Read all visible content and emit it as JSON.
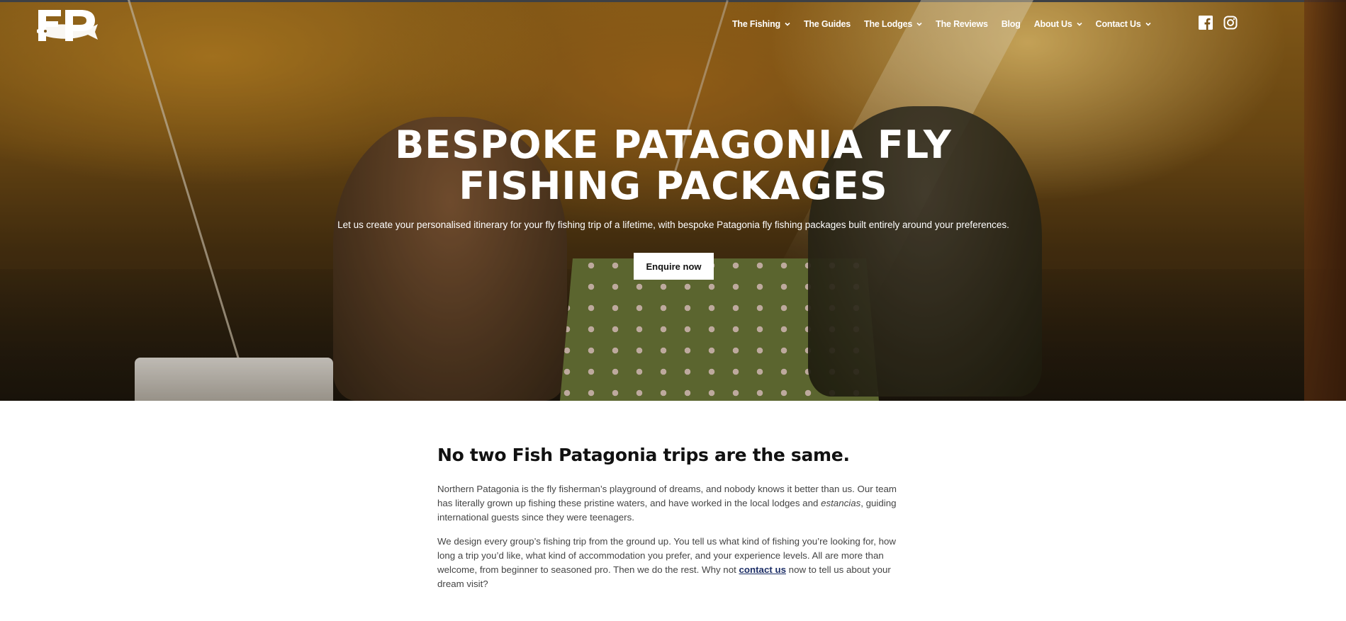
{
  "nav": {
    "items": [
      {
        "label": "The Fishing",
        "has_dropdown": true
      },
      {
        "label": "The Guides",
        "has_dropdown": false
      },
      {
        "label": "The Lodges",
        "has_dropdown": true
      },
      {
        "label": "The Reviews",
        "has_dropdown": false
      },
      {
        "label": "Blog",
        "has_dropdown": false
      },
      {
        "label": "About Us",
        "has_dropdown": true
      },
      {
        "label": "Contact Us",
        "has_dropdown": true
      }
    ],
    "social": {
      "facebook_icon": "facebook-icon",
      "instagram_icon": "instagram-icon"
    }
  },
  "logo": {
    "text": "FP"
  },
  "hero": {
    "title_line1": "BESPOKE PATAGONIA FLY",
    "title_line2": "FISHING PACKAGES",
    "subtitle": "Let us create your personalised itinerary for your fly fishing trip of a lifetime, with bespoke Patagonia fly fishing packages built entirely around your preferences.",
    "cta_label": "Enquire now"
  },
  "intro": {
    "heading": "No two Fish Patagonia trips are the same.",
    "p1_part1": "Northern Patagonia is the fly fisherman’s playground of dreams, and nobody knows it better than us. Our team has literally grown up fishing these pristine waters, and have worked in the local lodges and ",
    "p1_em": "estancias",
    "p1_part2": ", guiding international guests since they were teenagers.",
    "p2_part1": "We design every group’s fishing trip from the ground up. You tell us what kind of fishing you’re looking for,  how long a trip you’d like, what kind of accommodation you prefer, and your experience levels. All are more than welcome, from beginner to seasoned pro. Then we do the rest. Why not ",
    "p2_link": "contact us",
    "p2_part2": " now to tell us about your dream visit?"
  },
  "colors": {
    "link": "#1c2e66",
    "heading": "#111111",
    "body_text": "#444444"
  }
}
